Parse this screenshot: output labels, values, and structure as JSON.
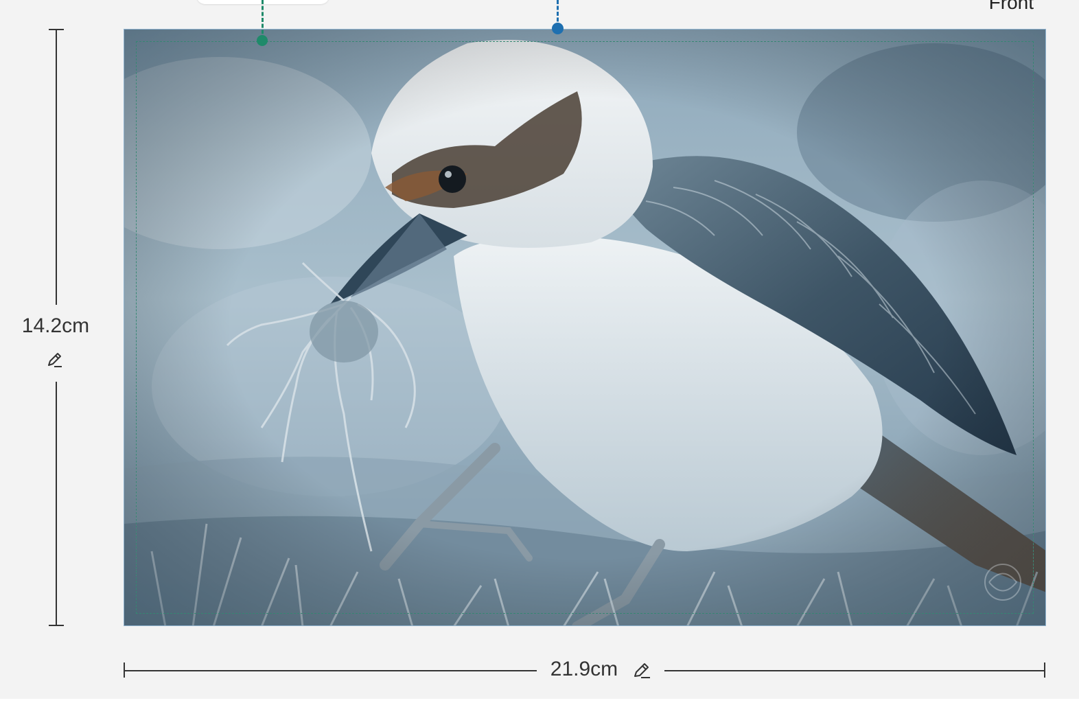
{
  "page": {
    "side_label": "Front"
  },
  "dimensions": {
    "height_label": "14.2cm",
    "width_label": "21.9cm",
    "edit_icon": "pencil-icon"
  },
  "colors": {
    "background": "#f3f3f3",
    "canvas_border": "#8fb3cf",
    "bleed_line": "#1f8a6a",
    "guide_marker": "#1e6fb0",
    "safe_zone": "#ffffff",
    "dimension_line": "#333333"
  },
  "photo": {
    "subject": "kookaburra-bird-on-frosted-grass"
  }
}
